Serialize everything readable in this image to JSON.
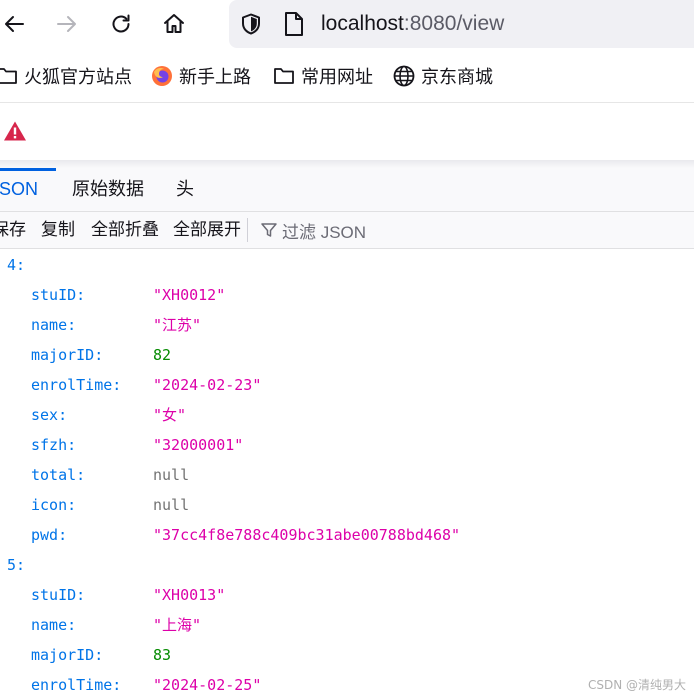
{
  "browser": {
    "url_host": "localhost",
    "url_rest": ":8080/view",
    "bookmarks": [
      {
        "label": "火狐官方站点",
        "icon": "folder-icon"
      },
      {
        "label": "新手上路",
        "icon": "firefox-icon"
      },
      {
        "label": "常用网址",
        "icon": "folder-icon"
      },
      {
        "label": "京东商城",
        "icon": "globe-icon"
      }
    ],
    "notice_icon": "warning-icon"
  },
  "viewer": {
    "tabs": [
      "JSON",
      "原始数据",
      "头"
    ],
    "active_tab": "JSON",
    "toolbar": {
      "save": "保存",
      "copy": "复制",
      "collapse_all": "全部折叠",
      "expand_all": "全部展开",
      "filter_placeholder": "过滤 JSON"
    }
  },
  "json_rows": [
    {
      "kind": "index",
      "key": "4:"
    },
    {
      "kind": "prop",
      "key": "stuID:",
      "value": "\"XH0012\"",
      "type": "str"
    },
    {
      "kind": "prop",
      "key": "name:",
      "value": "\"江苏\"",
      "type": "str"
    },
    {
      "kind": "prop",
      "key": "majorID:",
      "value": "82",
      "type": "num"
    },
    {
      "kind": "prop",
      "key": "enrolTime:",
      "value": "\"2024-02-23\"",
      "type": "str"
    },
    {
      "kind": "prop",
      "key": "sex:",
      "value": "\"女\"",
      "type": "str"
    },
    {
      "kind": "prop",
      "key": "sfzh:",
      "value": "\"32000001\"",
      "type": "str"
    },
    {
      "kind": "prop",
      "key": "total:",
      "value": "null",
      "type": "nul"
    },
    {
      "kind": "prop",
      "key": "icon:",
      "value": "null",
      "type": "nul"
    },
    {
      "kind": "prop",
      "key": "pwd:",
      "value": "\"37cc4f8e788c409bc31abe00788bd468\"",
      "type": "str"
    },
    {
      "kind": "index",
      "key": "5:"
    },
    {
      "kind": "prop",
      "key": "stuID:",
      "value": "\"XH0013\"",
      "type": "str"
    },
    {
      "kind": "prop",
      "key": "name:",
      "value": "\"上海\"",
      "type": "str"
    },
    {
      "kind": "prop",
      "key": "majorID:",
      "value": "83",
      "type": "num"
    },
    {
      "kind": "prop",
      "key": "enrolTime:",
      "value": "\"2024-02-25\"",
      "type": "str"
    }
  ],
  "watermark": "CSDN @清纯男大"
}
